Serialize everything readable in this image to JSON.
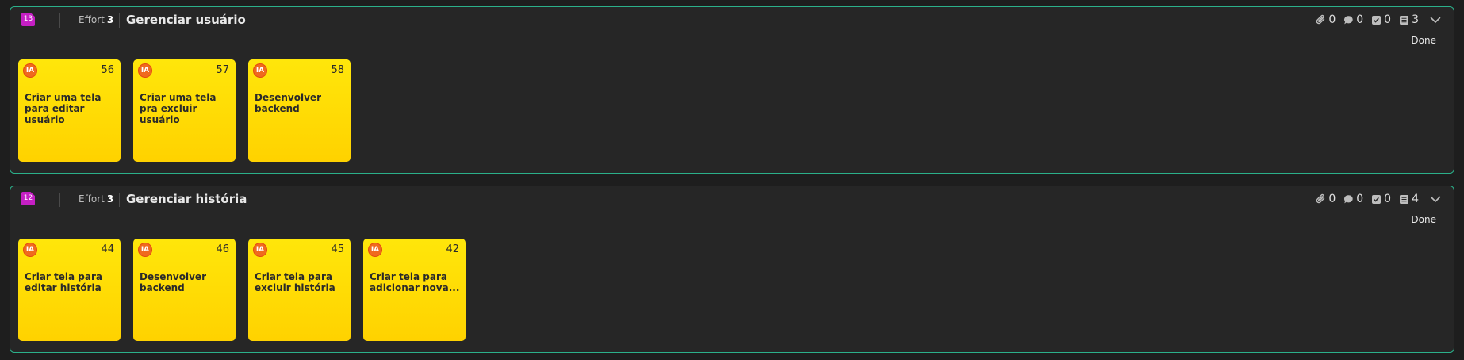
{
  "stories": [
    {
      "badge": "13",
      "effort_label": "Effort",
      "effort_value": "3",
      "title": "Gerenciar usuário",
      "stats": {
        "attachments": "0",
        "comments": "0",
        "checklist": "0",
        "tasks": "3"
      },
      "status": "Done",
      "cards": [
        {
          "avatar": "IA",
          "number": "56",
          "title": "Criar uma tela para editar usuário"
        },
        {
          "avatar": "IA",
          "number": "57",
          "title": "Criar uma tela pra excluir usuário"
        },
        {
          "avatar": "IA",
          "number": "58",
          "title": "Desenvolver backend"
        }
      ]
    },
    {
      "badge": "12",
      "effort_label": "Effort",
      "effort_value": "3",
      "title": "Gerenciar história",
      "stats": {
        "attachments": "0",
        "comments": "0",
        "checklist": "0",
        "tasks": "4"
      },
      "status": "Done",
      "cards": [
        {
          "avatar": "IA",
          "number": "44",
          "title": "Criar tela para editar história"
        },
        {
          "avatar": "IA",
          "number": "46",
          "title": "Desenvolver backend"
        },
        {
          "avatar": "IA",
          "number": "45",
          "title": "Criar tela para excluir história"
        },
        {
          "avatar": "IA",
          "number": "42",
          "title": "Criar tela para adicionar nova..."
        }
      ]
    }
  ],
  "colors": {
    "background": "#1e1e1e",
    "panel": "#262626",
    "border": "#2bb08a",
    "badge": "#c51fc4",
    "card_top": "#ffe60a",
    "card_bottom": "#ffd200",
    "avatar": "#f06a1e"
  },
  "icons": {
    "attachments": "paperclip-icon",
    "comments": "comment-icon",
    "checklist": "checkbox-icon",
    "tasks": "list-icon",
    "toggle": "chevron-down-icon"
  }
}
